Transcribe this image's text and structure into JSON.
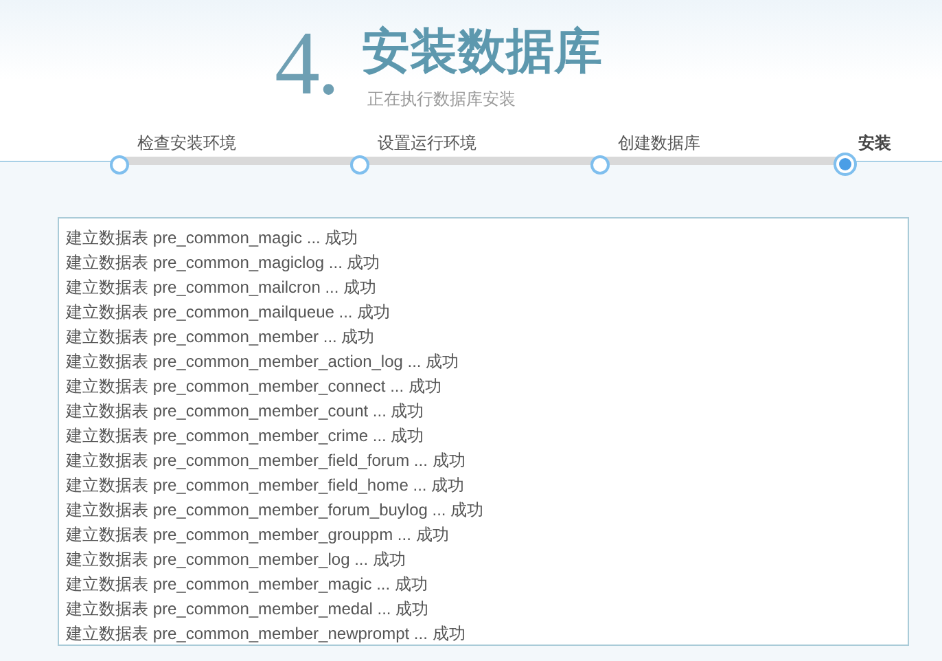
{
  "header": {
    "step_number": "4.",
    "title": "安装数据库",
    "subtitle": "正在执行数据库安装"
  },
  "steps": [
    {
      "label": "检查安装环境",
      "selected": false
    },
    {
      "label": "设置运行环境",
      "selected": false
    },
    {
      "label": "创建数据库",
      "selected": false
    },
    {
      "label": "安装",
      "selected": true
    }
  ],
  "log": [
    "建立数据表 pre_common_magic ... 成功",
    "建立数据表 pre_common_magiclog ... 成功",
    "建立数据表 pre_common_mailcron ... 成功",
    "建立数据表 pre_common_mailqueue ... 成功",
    "建立数据表 pre_common_member ... 成功",
    "建立数据表 pre_common_member_action_log ... 成功",
    "建立数据表 pre_common_member_connect ... 成功",
    "建立数据表 pre_common_member_count ... 成功",
    "建立数据表 pre_common_member_crime ... 成功",
    "建立数据表 pre_common_member_field_forum ... 成功",
    "建立数据表 pre_common_member_field_home ... 成功",
    "建立数据表 pre_common_member_forum_buylog ... 成功",
    "建立数据表 pre_common_member_grouppm ... 成功",
    "建立数据表 pre_common_member_log ... 成功",
    "建立数据表 pre_common_member_magic ... 成功",
    "建立数据表 pre_common_member_medal ... 成功",
    "建立数据表 pre_common_member_newprompt ... 成功"
  ]
}
